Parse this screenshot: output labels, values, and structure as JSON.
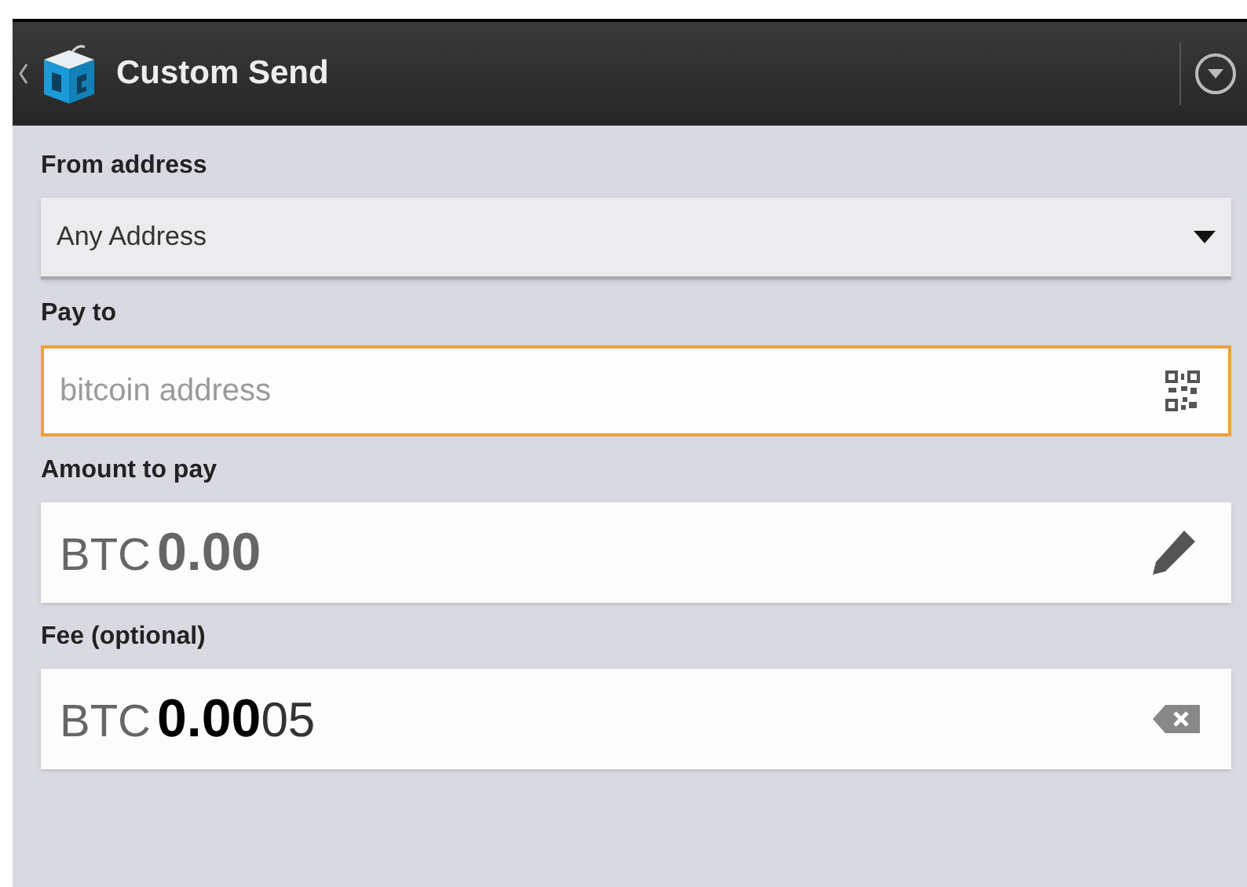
{
  "action_bar": {
    "title": "Custom Send"
  },
  "fields": [
    {
      "kind": "dropdown",
      "label": "From address",
      "value": "Any Address"
    },
    {
      "kind": "address",
      "label": "Pay to",
      "placeholder": "bitcoin address",
      "focused": true
    },
    {
      "kind": "amount",
      "label": "Amount to pay",
      "unit": "BTC",
      "value": "0.00"
    },
    {
      "kind": "fee",
      "label": "Fee (optional)",
      "unit": "BTC",
      "value": "**0.00**05"
    }
  ]
}
